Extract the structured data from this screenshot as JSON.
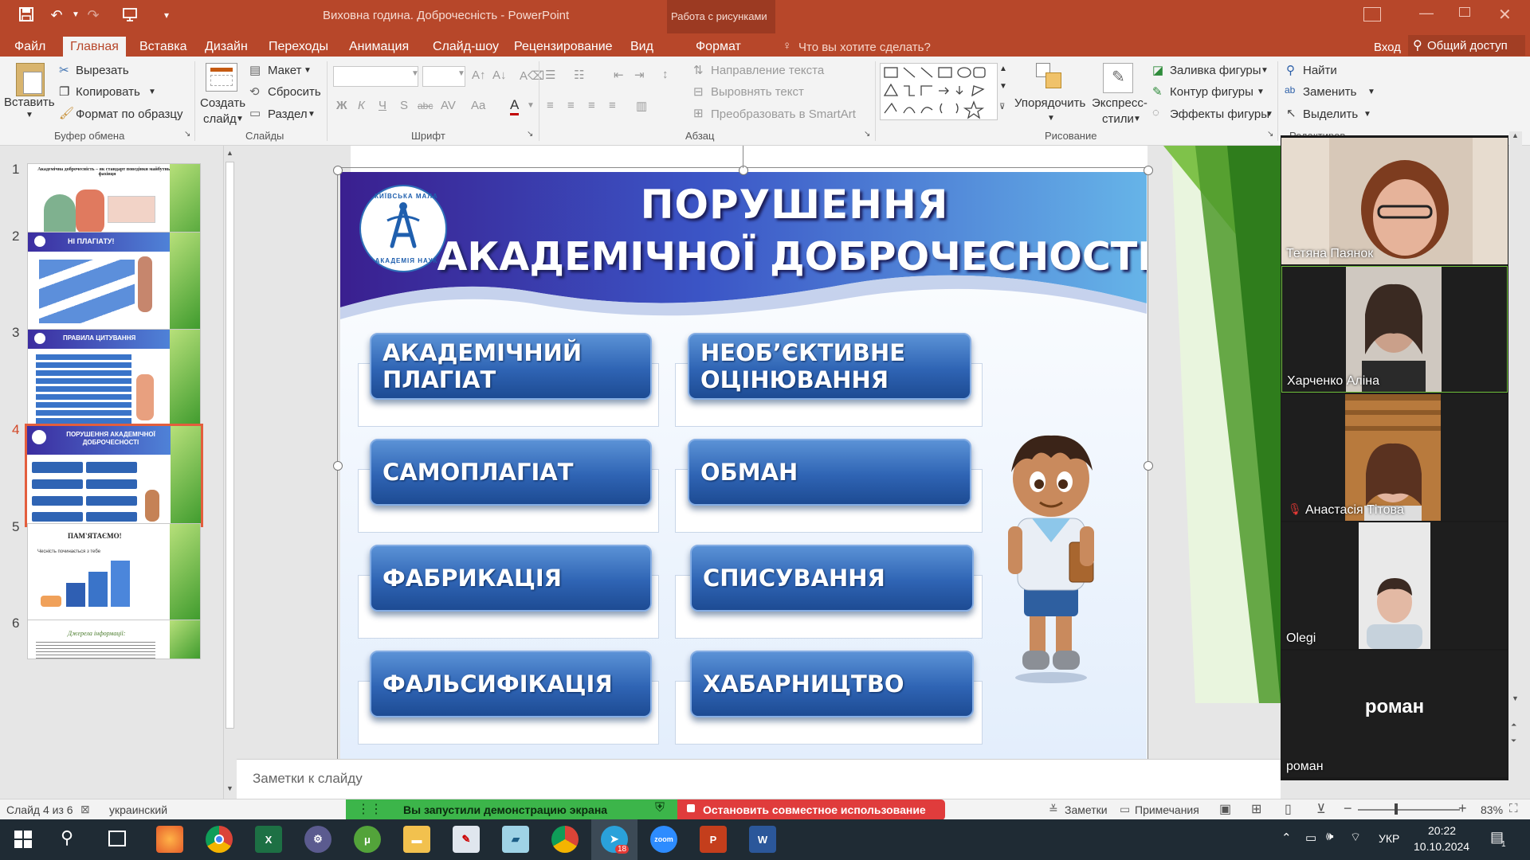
{
  "window": {
    "title": "Виховна година. Доброчесність - PowerPoint",
    "context_group": "Работа с рисунками"
  },
  "tabs": [
    "Файл",
    "Главная",
    "Вставка",
    "Дизайн",
    "Переходы",
    "Анимация",
    "Слайд-шоу",
    "Рецензирование",
    "Вид",
    "Формат"
  ],
  "active_tab": "Главная",
  "tell_me": "Что вы хотите сделать?",
  "sign_in": "Вход",
  "share": "Общий доступ",
  "ribbon": {
    "clipboard": {
      "paste": "Вставить",
      "cut": "Вырезать",
      "copy": "Копировать",
      "format_painter": "Формат по образцу",
      "label": "Буфер обмена"
    },
    "slides": {
      "new_slide": "Создать",
      "new_slide_2": "слайд",
      "layout": "Макет",
      "reset": "Сбросить",
      "section": "Раздел",
      "label": "Слайды"
    },
    "font": {
      "label": "Шрифт",
      "bold": "Ж",
      "italic": "К",
      "underline": "Ч",
      "shadow": "S",
      "strike": "abc",
      "spacing": "AV",
      "case": "Aa",
      "color": "A"
    },
    "paragraph": {
      "text_direction": "Направление текста",
      "align_text": "Выровнять текст",
      "smartart": "Преобразовать в SmartArt",
      "label": "Абзац"
    },
    "drawing": {
      "arrange": "Упорядочить",
      "quick_styles": "Экспресс-",
      "quick_styles_2": "стили",
      "fill": "Заливка фигуры",
      "outline": "Контур фигуры",
      "effects": "Эффекты фигуры",
      "label": "Рисование"
    },
    "editing": {
      "find": "Найти",
      "replace": "Заменить",
      "select": "Выделить",
      "label": "Редактирование"
    }
  },
  "thumbnails": [
    {
      "num": "1",
      "title": "Академічна доброчесність – як стандарт поведінки майбутнього фахівця"
    },
    {
      "num": "2",
      "title": "НІ ПЛАГІАТУ!"
    },
    {
      "num": "3",
      "title": "ПРАВИЛА ЦИТУВАННЯ"
    },
    {
      "num": "4",
      "title": "ПОРУШЕННЯ АКАДЕМІЧНОЇ ДОБРОЧЕСНОСТІ"
    },
    {
      "num": "5",
      "title": "ПАМ'ЯТАЄМО!",
      "subtitle": "Чесність починається з тебе"
    },
    {
      "num": "6",
      "title": "Джерела інформації:"
    }
  ],
  "slide": {
    "title_line1": "ПОРУШЕННЯ",
    "title_line2": "АКАДЕМІЧНОЇ ДОБРОЧЕСНОСТІ",
    "logo_top": "КИЇВСЬКА МАЛА",
    "logo_bottom": "АКАДЕМІЯ НАУК",
    "categories": [
      {
        "line1": "АКАДЕМІЧНИЙ",
        "line2": "ПЛАГІАТ"
      },
      {
        "line1": "НЕОБ’ЄКТИВНЕ",
        "line2": "ОЦІНЮВАННЯ"
      },
      {
        "line1": "САМОПЛАГІАТ",
        "line2": ""
      },
      {
        "line1": "ОБМАН",
        "line2": ""
      },
      {
        "line1": "ФАБРИКАЦІЯ",
        "line2": ""
      },
      {
        "line1": "СПИСУВАННЯ",
        "line2": ""
      },
      {
        "line1": "ФАЛЬСИФІКАЦІЯ",
        "line2": ""
      },
      {
        "line1": "ХАБАРНИЦТВО",
        "line2": ""
      }
    ]
  },
  "notes_placeholder": "Заметки к слайду",
  "participants": [
    {
      "name": "Тетяна Паянок",
      "muted": false
    },
    {
      "name": "Харченко Аліна",
      "muted": false
    },
    {
      "name": "Анастасія Тітова",
      "muted": true
    },
    {
      "name": "Olegi",
      "muted": false
    },
    {
      "name": "роман",
      "muted": false,
      "avatar_text": "роман"
    }
  ],
  "status": {
    "slide_info": "Слайд 4 из 6",
    "language": "украинский",
    "notes": "Заметки",
    "comments": "Примечания",
    "zoom": "83%"
  },
  "screen_share": {
    "message": "Вы запустили демонстрацию экрана",
    "stop": "Остановить совместное использование"
  },
  "taskbar": {
    "time": "20:22",
    "date": "10.10.2024",
    "lang": "УКР",
    "telegram_badge": "18",
    "notif_badge": "1"
  }
}
